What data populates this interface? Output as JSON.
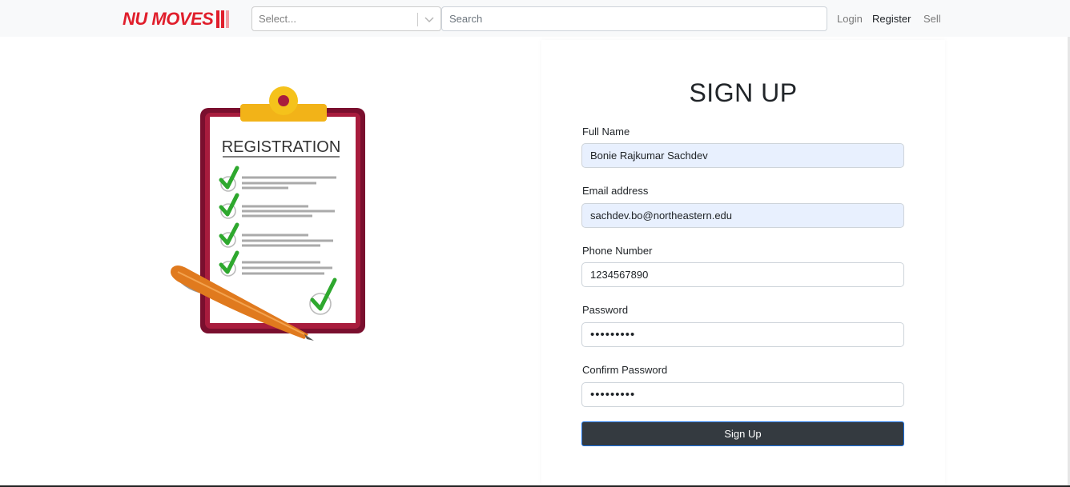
{
  "navbar": {
    "brand": "NU MOVES",
    "select_placeholder": "Select...",
    "search_placeholder": "Search",
    "links": {
      "login": "Login",
      "register": "Register",
      "sell": "Sell"
    }
  },
  "illustration": {
    "heading": "REGISTRATION"
  },
  "form": {
    "title": "SIGN UP",
    "fields": {
      "full_name": {
        "label": "Full Name",
        "value": "Bonie Rajkumar Sachdev"
      },
      "email": {
        "label": "Email address",
        "value": "sachdev.bo@northeastern.edu"
      },
      "phone": {
        "label": "Phone Number",
        "value": "1234567890"
      },
      "password": {
        "label": "Password",
        "value": "•••••••••"
      },
      "confirm_password": {
        "label": "Confirm Password",
        "value": "•••••••••"
      }
    },
    "submit_label": "Sign Up"
  },
  "colors": {
    "brand": "#e01e2b",
    "button": "#343a40",
    "autofill": "#e8f0fe",
    "check": "#2ea82e",
    "clipboard": "#8b1538"
  }
}
